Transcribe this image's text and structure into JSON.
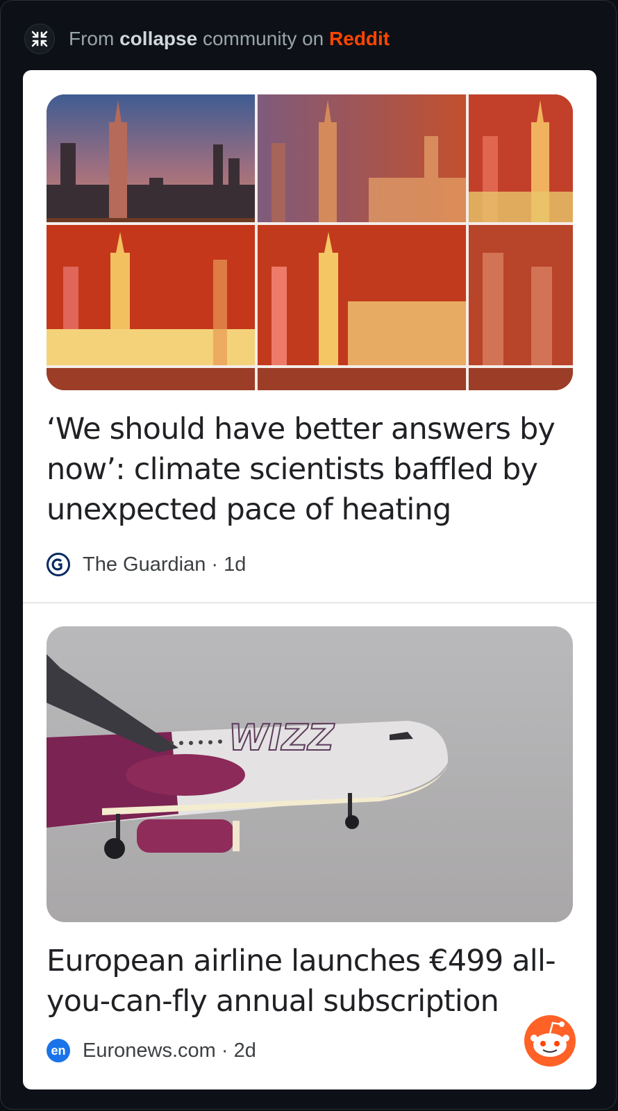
{
  "header": {
    "prefix": "From ",
    "community": "collapse",
    "middle": " community on ",
    "platform": "Reddit",
    "icons": {
      "collapse": "collapse-arrows-icon"
    }
  },
  "articles": [
    {
      "headline": "‘We should have better answers by now’: climate scientists baffled by unexpected pace of heating",
      "source": "The Guardian",
      "age": "1d",
      "meta_text": "The Guardian · 1d",
      "logo": "guardian-logo",
      "image": "city-skyline-heat-sequence"
    },
    {
      "headline": "European airline launches €499 all-you-can-fly annual subscription",
      "source": "Euronews.com",
      "age": "2d",
      "meta_text": "Euronews.com · 2d",
      "logo_text": "en",
      "logo": "euronews-logo",
      "image": "wizz-air-plane",
      "image_text": "WIZZ"
    }
  ],
  "icons": {
    "like": "heart-icon",
    "share": "share-icon",
    "more": "more-vertical-icon",
    "reddit": "reddit-snoo-icon"
  },
  "colors": {
    "reddit_orange": "#ff4500",
    "background": "#0d1117",
    "card": "#ffffff"
  }
}
